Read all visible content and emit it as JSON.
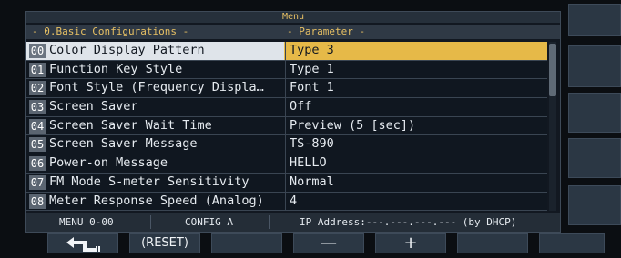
{
  "menu": {
    "title": "Menu",
    "section_header": "- 0.Basic Configurations -",
    "param_header": "- Parameter -",
    "items": [
      {
        "index": "00",
        "name": "Color Display Pattern",
        "value": "Type 3",
        "selected": true
      },
      {
        "index": "01",
        "name": "Function Key Style",
        "value": "Type 1"
      },
      {
        "index": "02",
        "name": "Font Style (Frequency Displa…",
        "value": "Font 1"
      },
      {
        "index": "03",
        "name": "Screen Saver",
        "value": "Off"
      },
      {
        "index": "04",
        "name": "Screen Saver Wait Time",
        "value": "Preview (5 [sec])"
      },
      {
        "index": "05",
        "name": "Screen Saver Message",
        "value": "TS-890"
      },
      {
        "index": "06",
        "name": "Power-on Message",
        "value": "HELLO"
      },
      {
        "index": "07",
        "name": "FM Mode S-meter Sensitivity",
        "value": "Normal"
      },
      {
        "index": "08",
        "name": "Meter Response Speed (Analog)",
        "value": "4"
      }
    ]
  },
  "status": {
    "menu_range": "MENU 0-00",
    "config": "CONFIG A",
    "ip": "IP Address:---.---.---.--- (by DHCP)"
  },
  "softkeys": {
    "f1_icon": "back-arrow-icon",
    "f2_label": "(RESET)",
    "f3_label": "",
    "f4_label": "—",
    "f5_label": "+",
    "f6_label": "",
    "f7_label": ""
  },
  "colors": {
    "highlight": "#e6b948",
    "header_text": "#e7c064",
    "background": "#121821"
  }
}
